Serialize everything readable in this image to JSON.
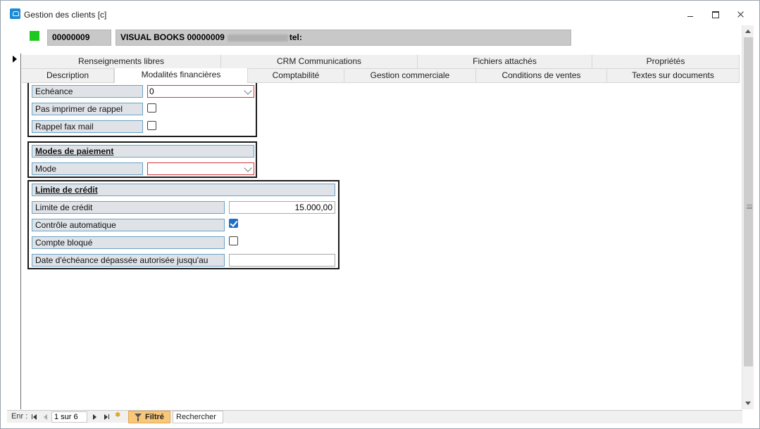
{
  "window": {
    "title": "Gestion des clients [c]"
  },
  "header": {
    "code": "00000009",
    "name": "VISUAL BOOKS 00000009",
    "tel_label": "tel:",
    "status_color": "#1ec81e"
  },
  "tabs_row1": [
    "Renseignements libres",
    "CRM Communications",
    "Fichiers attachés",
    "Propriétés"
  ],
  "tabs_row2": [
    "Description",
    "Modalités financières",
    "Comptabilité",
    "Gestion commerciale",
    "Conditions de ventes",
    "Textes sur documents"
  ],
  "active_tab": "Modalités financières",
  "echeance_frame": {
    "echeance_label": "Echéance",
    "echeance_value": "0",
    "pas_imprimer_label": "Pas imprimer de rappel",
    "pas_imprimer_checked": false,
    "rappel_fax_label": "Rappel fax mail",
    "rappel_fax_checked": false
  },
  "modes_frame": {
    "title": "Modes de paiement",
    "mode_label": "Mode",
    "mode_value": ""
  },
  "credit_frame": {
    "title": "Limite de crédit",
    "limite_label": "Limite de crédit",
    "limite_value": "15.000,00",
    "controle_label": "Contrôle automatique",
    "controle_checked": true,
    "bloque_label": "Compte bloqué",
    "bloque_checked": false,
    "date_label": "Date d'échéance dépassée autorisée jusqu'au",
    "date_value": ""
  },
  "navigation": {
    "record_label": "Enr :",
    "position": "1 sur 6",
    "filter_label": "Filtré",
    "search_label": "Rechercher"
  },
  "colors": {
    "required_border": "#d43a3a",
    "label_bg": "#dfe3e8",
    "label_border": "#6aa2c7",
    "filter_bg": "#f9c77a",
    "checkbox_accent": "#1f6fc5"
  }
}
